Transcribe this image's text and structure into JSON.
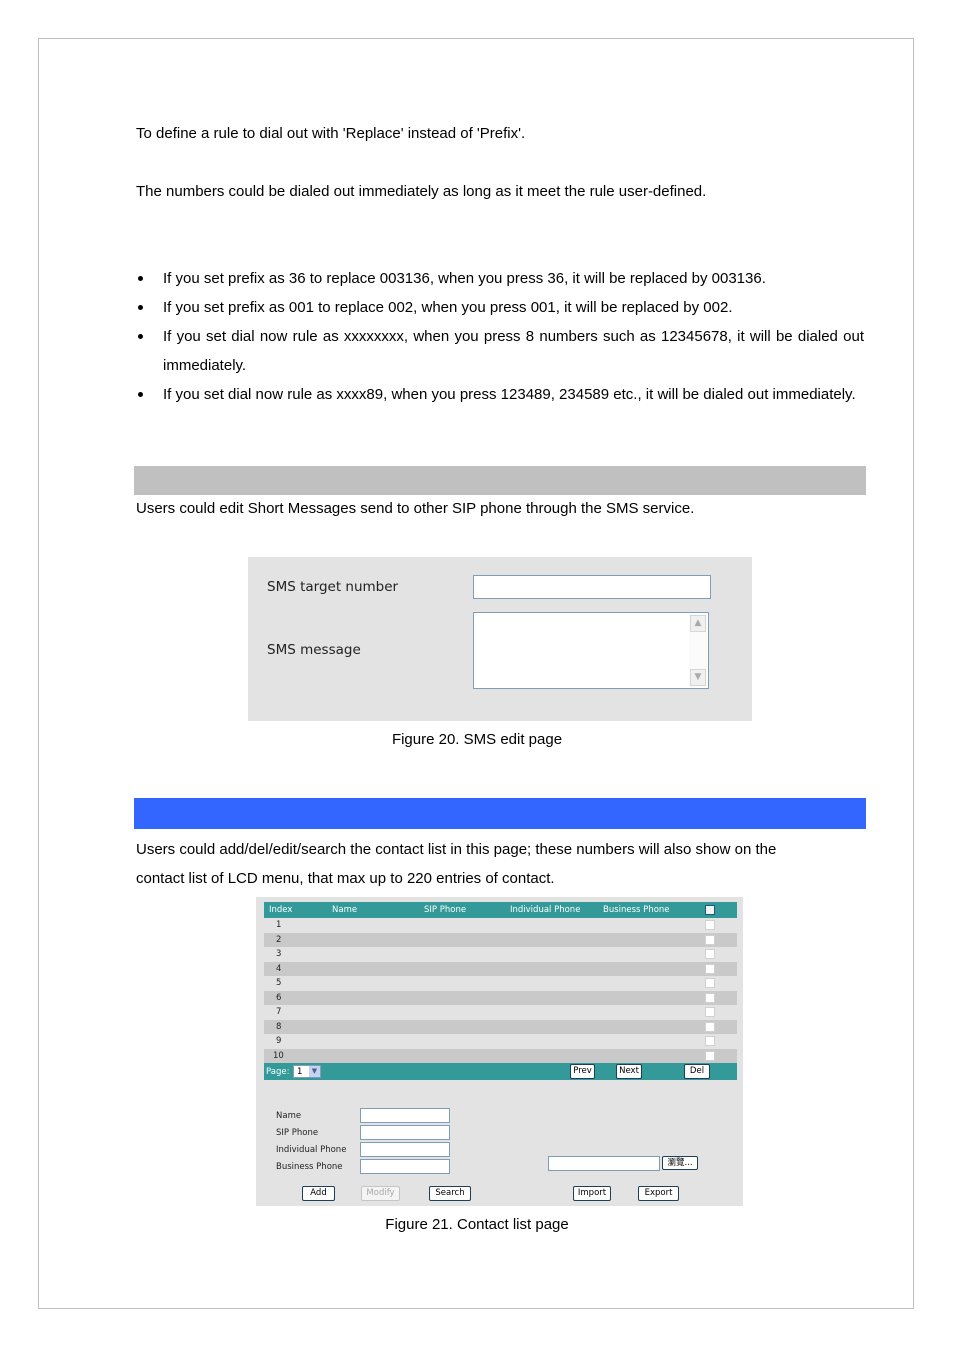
{
  "intro": {
    "line1": "To define a rule to dial out with 'Replace' instead of 'Prefix'.",
    "line2": "The numbers could be dialed out immediately as long as it meet the rule user-defined."
  },
  "bullets": [
    "If you set prefix as 36 to replace 003136, when you press 36, it will be replaced by 003136.",
    "If you set prefix as 001 to replace 002, when you press 001, it will be replaced by 002.",
    "If you set dial now rule as xxxxxxxx, when you press 8 numbers such as 12345678, it will be dialed out immediately.",
    "If you set dial now rule as xxxx89, when you press 123489, 234589 etc., it will be dialed out immediately."
  ],
  "sms_section": {
    "bar_color": "#c0c0c0",
    "description": "Users could edit Short Messages send to other SIP phone through the SMS service.",
    "figure": {
      "target_label": "SMS target number",
      "target_value": "",
      "message_label": "SMS message",
      "message_value": ""
    },
    "caption": "Figure 20. SMS edit page"
  },
  "contact_section": {
    "bar_color": "#3366ff",
    "description_line1": "Users could add/del/edit/search the contact list in this page; these numbers will also show on the",
    "description_line2": "contact list of LCD menu, that max up to 220 entries of contact.",
    "figure": {
      "columns": [
        "Index",
        "Name",
        "SIP Phone",
        "Individual Phone",
        "Business Phone"
      ],
      "rows": [
        {
          "index": "1"
        },
        {
          "index": "2"
        },
        {
          "index": "3"
        },
        {
          "index": "4"
        },
        {
          "index": "5"
        },
        {
          "index": "6"
        },
        {
          "index": "7"
        },
        {
          "index": "8"
        },
        {
          "index": "9"
        },
        {
          "index": "10"
        }
      ],
      "page_label": "Page:",
      "page_value": "1",
      "prev_label": "Prev",
      "next_label": "Next",
      "del_label": "Del",
      "form": {
        "name_label": "Name",
        "sip_label": "SIP Phone",
        "individual_label": "Individual Phone",
        "business_label": "Business Phone"
      },
      "browse_label": "瀏覽...",
      "add_label": "Add",
      "modify_label": "Modify",
      "search_label": "Search",
      "import_label": "Import",
      "export_label": "Export",
      "header_color": "#339999"
    },
    "caption": "Figure 21. Contact list page"
  }
}
